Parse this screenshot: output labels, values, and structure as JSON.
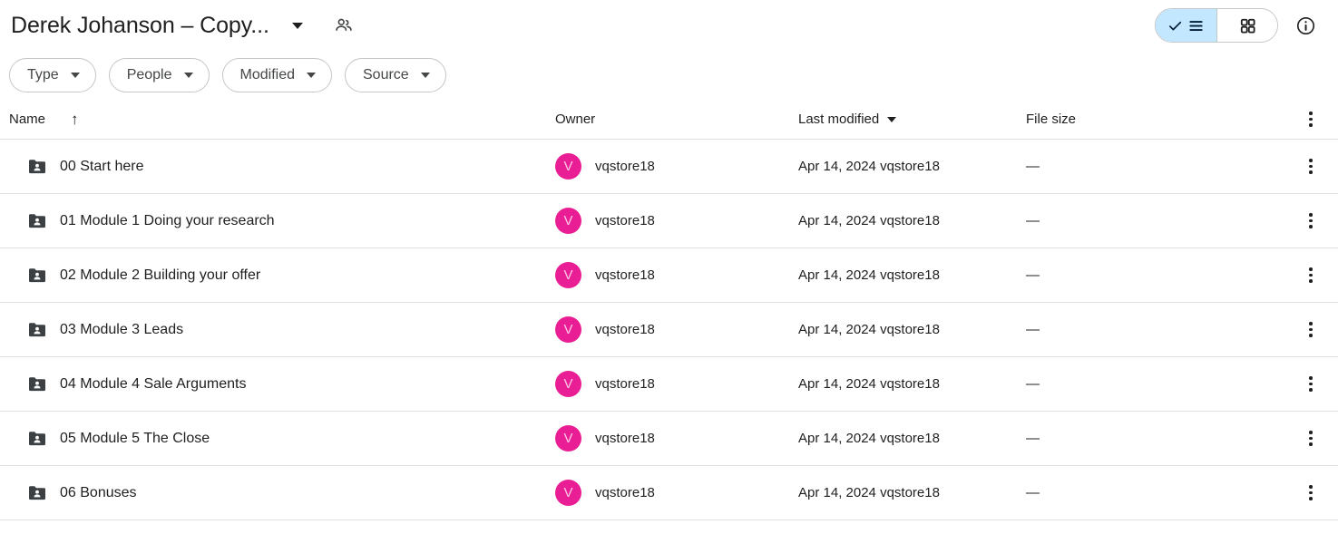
{
  "header": {
    "title": "Derek Johanson – Copy...",
    "title_caret_icon": "chevron-down-icon",
    "shared_icon": "people-shared-icon",
    "view_toggle": {
      "list_label": "",
      "list_icon": "list-view-icon",
      "list_check_icon": "check-icon",
      "grid_icon": "grid-view-icon",
      "selected": "list"
    },
    "info_icon": "info-circle-icon"
  },
  "filters": [
    {
      "label": "Type",
      "caret_icon": "chevron-down-icon"
    },
    {
      "label": "People",
      "caret_icon": "chevron-down-icon"
    },
    {
      "label": "Modified",
      "caret_icon": "chevron-down-icon"
    },
    {
      "label": "Source",
      "caret_icon": "chevron-down-icon"
    }
  ],
  "table": {
    "columns": {
      "name": "Name",
      "name_sort_icon": "sort-ascending-arrow-icon",
      "owner": "Owner",
      "last_modified": "Last modified",
      "last_modified_caret_icon": "chevron-down-icon",
      "file_size": "File size",
      "menu_icon": "more-options-icon"
    },
    "rows": [
      {
        "icon": "shared-folder-icon",
        "name": "00 Start here",
        "owner_initial": "V",
        "owner": "vqstore18",
        "last_modified": "Apr 14, 2024 vqstore18",
        "file_size": "—",
        "menu_icon": "more-options-icon"
      },
      {
        "icon": "shared-folder-icon",
        "name": "01 Module 1 Doing your research",
        "owner_initial": "V",
        "owner": "vqstore18",
        "last_modified": "Apr 14, 2024 vqstore18",
        "file_size": "—",
        "menu_icon": "more-options-icon"
      },
      {
        "icon": "shared-folder-icon",
        "name": "02 Module 2 Building your offer",
        "owner_initial": "V",
        "owner": "vqstore18",
        "last_modified": "Apr 14, 2024 vqstore18",
        "file_size": "—",
        "menu_icon": "more-options-icon"
      },
      {
        "icon": "shared-folder-icon",
        "name": "03 Module 3 Leads",
        "owner_initial": "V",
        "owner": "vqstore18",
        "last_modified": "Apr 14, 2024 vqstore18",
        "file_size": "—",
        "menu_icon": "more-options-icon"
      },
      {
        "icon": "shared-folder-icon",
        "name": "04 Module 4 Sale Arguments",
        "owner_initial": "V",
        "owner": "vqstore18",
        "last_modified": "Apr 14, 2024 vqstore18",
        "file_size": "—",
        "menu_icon": "more-options-icon"
      },
      {
        "icon": "shared-folder-icon",
        "name": "05 Module 5 The Close",
        "owner_initial": "V",
        "owner": "vqstore18",
        "last_modified": "Apr 14, 2024 vqstore18",
        "file_size": "—",
        "menu_icon": "more-options-icon"
      },
      {
        "icon": "shared-folder-icon",
        "name": "06 Bonuses",
        "owner_initial": "V",
        "owner": "vqstore18",
        "last_modified": "Apr 14, 2024 vqstore18",
        "file_size": "—",
        "menu_icon": "more-options-icon"
      }
    ]
  },
  "colors": {
    "avatar_bg": "#e91e94",
    "avatar_fg": "#fbc8e6",
    "toggle_active_bg": "#c2e7ff",
    "folder_icon": "#3c4043",
    "divider": "#e0e0e0"
  }
}
